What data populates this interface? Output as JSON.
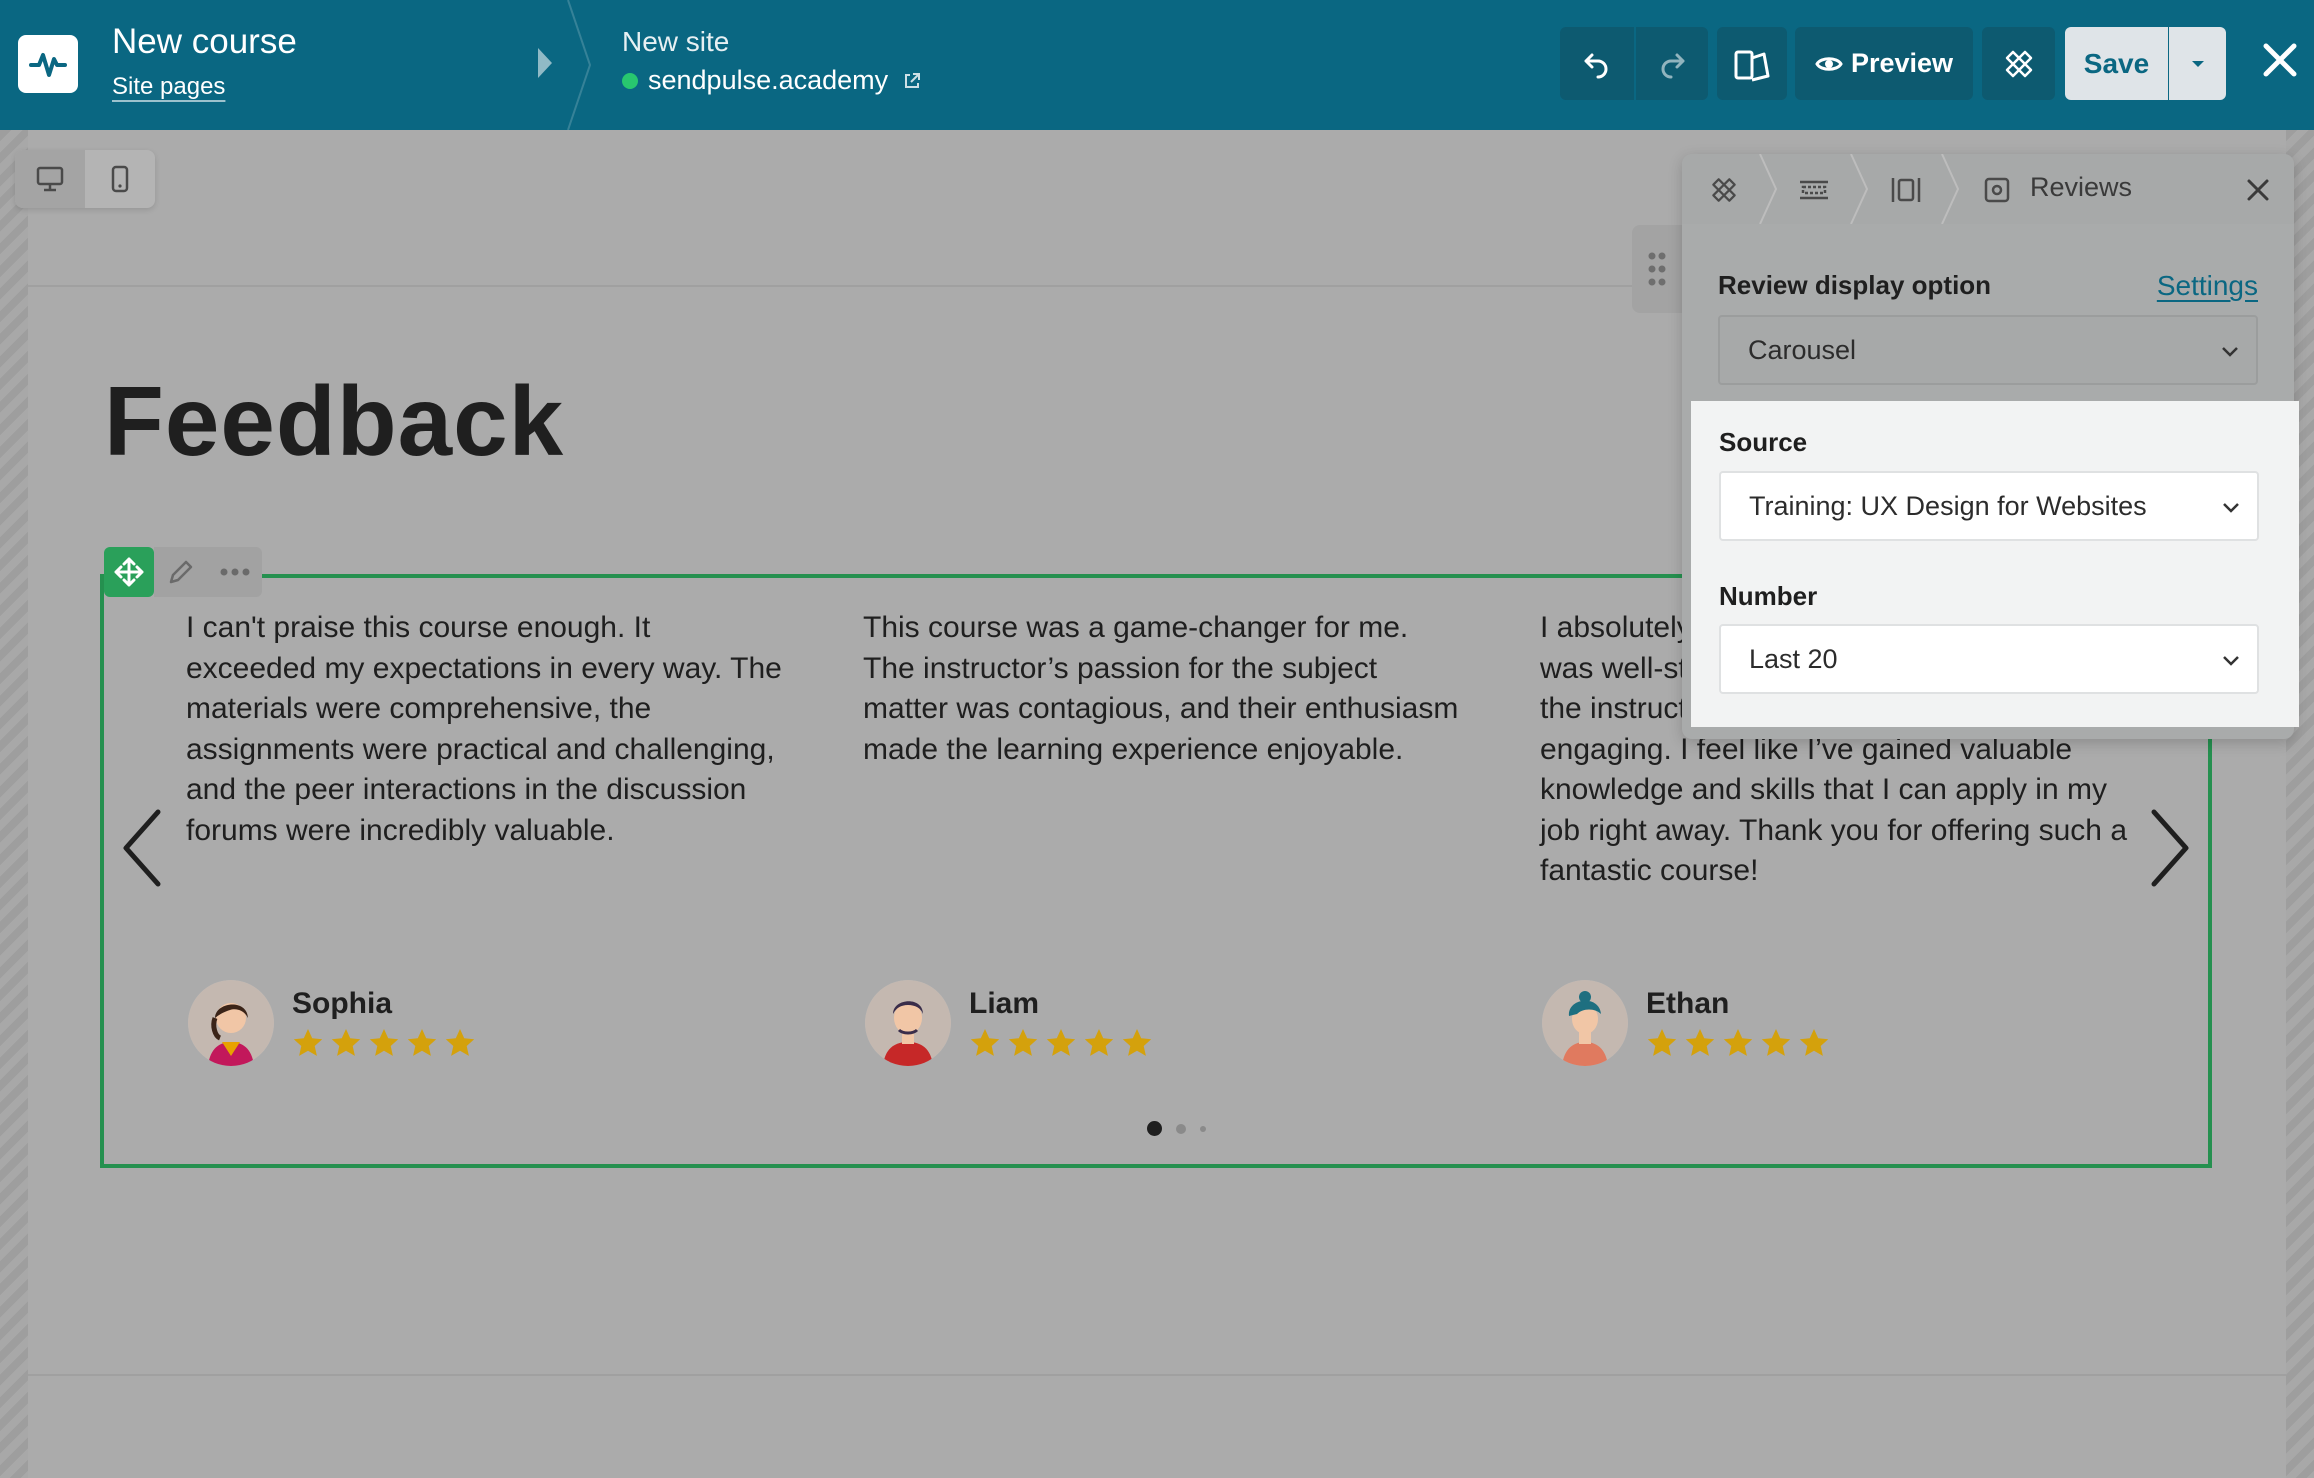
{
  "header": {
    "course_title": "New course",
    "site_pages_link": "Site pages",
    "site_label": "New site",
    "site_url": "sendpulse.academy",
    "preview_label": "Preview",
    "save_label": "Save"
  },
  "page": {
    "heading": "Feedback"
  },
  "reviews": [
    {
      "text": "I can't praise this course enough. It exceeded my expectations in every way. The materials were comprehensive, the assignments were practical and challenging, and the peer interactions in the discussion forums were incredibly valuable.",
      "name": "Sophia",
      "rating": 5
    },
    {
      "text": "This course was a game-changer for me. The instructor’s passion for the subject matter was contagious, and their enthusiasm made the learning experience enjoyable.",
      "name": "Liam",
      "rating": 5
    },
    {
      "text": "I absolutely loved this course! The content was well-structured and easy to follow, and the instructor was knowledgeable and engaging. I feel like I’ve gained valuable knowledge and skills that I can apply in my job right away. Thank you for offering such a fantastic course!",
      "name": "Ethan",
      "rating": 5
    }
  ],
  "carousel": {
    "pages": 3,
    "active_page": 1
  },
  "panel": {
    "title": "Reviews",
    "display_option_label": "Review display option",
    "settings_link": "Settings",
    "display_option_value": "Carousel",
    "source_label": "Source",
    "source_value": "Training: UX Design for Websites",
    "number_label": "Number",
    "number_value": "Last 20"
  },
  "colors": {
    "topbar": "#0a6782",
    "accent_green": "#25904f",
    "star": "#d4a10c",
    "online_dot": "#28c76f"
  }
}
